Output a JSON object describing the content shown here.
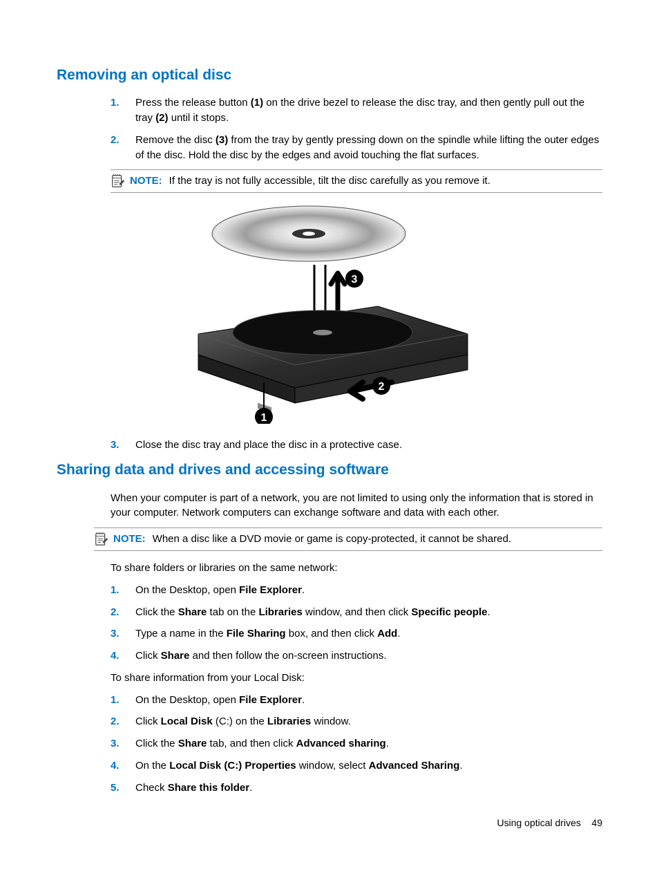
{
  "section1": {
    "heading": "Removing an optical disc",
    "steps": [
      {
        "num": "1.",
        "pre": "Press the release button ",
        "b1": "(1)",
        "mid": " on the drive bezel to release the disc tray, and then gently pull out the tray ",
        "b2": "(2)",
        "post": " until it stops."
      },
      {
        "num": "2.",
        "pre": "Remove the disc ",
        "b1": "(3)",
        "post": " from the tray by gently pressing down on the spindle while lifting the outer edges of the disc. Hold the disc by the edges and avoid touching the flat surfaces."
      }
    ],
    "note": {
      "label": "NOTE:",
      "text": "If the tray is not fully accessible, tilt the disc carefully as you remove it."
    },
    "step3": {
      "num": "3.",
      "text": "Close the disc tray and place the disc in a protective case."
    }
  },
  "section2": {
    "heading": "Sharing data and drives and accessing software",
    "intro": "When your computer is part of a network, you are not limited to using only the information that is stored in your computer. Network computers can exchange software and data with each other.",
    "note": {
      "label": "NOTE:",
      "text": "When a disc like a DVD movie or game is copy-protected, it cannot be shared."
    },
    "para_a": "To share folders or libraries on the same network:",
    "list_a": [
      {
        "num": "1.",
        "pre": "On the Desktop, open ",
        "b1": "File Explorer",
        "post": "."
      },
      {
        "num": "2.",
        "pre": "Click the ",
        "b1": "Share",
        "mid1": " tab on the ",
        "b2": "Libraries",
        "mid2": " window, and then click ",
        "b3": "Specific people",
        "post": "."
      },
      {
        "num": "3.",
        "pre": "Type a name in the ",
        "b1": "File Sharing",
        "mid1": " box, and then click ",
        "b2": "Add",
        "post": "."
      },
      {
        "num": "4.",
        "pre": "Click ",
        "b1": "Share",
        "post": " and then follow the on-screen instructions."
      }
    ],
    "para_b": "To share information from your Local Disk:",
    "list_b": [
      {
        "num": "1.",
        "pre": "On the Desktop, open ",
        "b1": "File Explorer",
        "post": "."
      },
      {
        "num": "2.",
        "pre": "Click ",
        "b1": "Local Disk ",
        "mid1": "(C:) on the ",
        "b2": "Libraries",
        "post": " window."
      },
      {
        "num": "3.",
        "pre": "Click the ",
        "b1": "Share",
        "mid1": " tab, and then click ",
        "b2": "Advanced sharing",
        "post": "."
      },
      {
        "num": "4.",
        "pre": "On the ",
        "b1": "Local Disk (C:) Properties",
        "mid1": " window, select ",
        "b2": "Advanced Sharing",
        "post": "."
      },
      {
        "num": "5.",
        "pre": "Check ",
        "b1": "Share this folder",
        "post": "."
      }
    ]
  },
  "footer": {
    "text": "Using optical drives",
    "page": "49"
  }
}
